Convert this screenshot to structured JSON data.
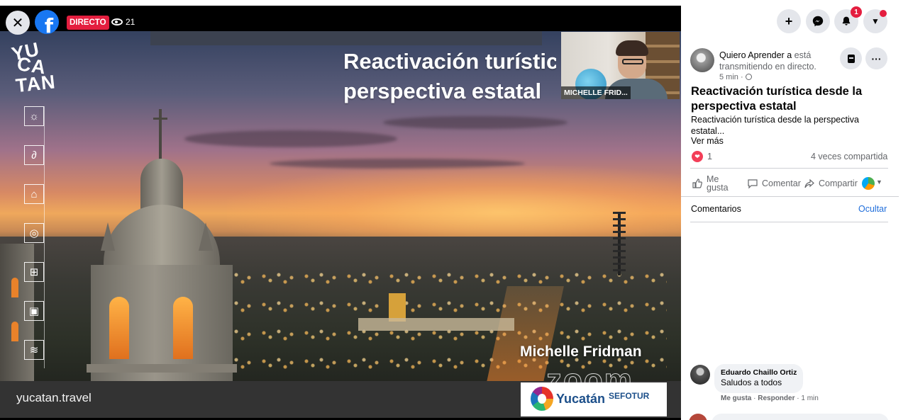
{
  "video": {
    "live_label": "DIRECTO",
    "viewer_count": "21",
    "slide_title": "Reactivación turístic\nperspectiva estatal",
    "brand_lines": [
      "YU",
      "CA",
      "TAN"
    ],
    "footer_site": "yucatan.travel",
    "speaker_name": "Michelle Fridman",
    "zoom_watermark": "zoom",
    "pip_label": "MICHELLE FRID...",
    "logo_word": "Yucatán",
    "logo_org": "SEFOTUR"
  },
  "topbar": {
    "notification_count": "1"
  },
  "post": {
    "page_name": "Quiero Aprender a",
    "status_text": "está transmitiendo en directo.",
    "time": "5 min ·",
    "title": "Reactivación turística desde la perspectiva estatal",
    "description": "Reactivación turística desde la perspectiva estatal...",
    "see_more": "Ver más",
    "reaction_count": "1",
    "shares": "4 veces compartida"
  },
  "actions": {
    "like": "Me gusta",
    "comment": "Comentar",
    "share": "Compartir"
  },
  "comments": {
    "header": "Comentarios",
    "hide": "Ocultar",
    "items": [
      {
        "author": "Eduardo Chaillo Ortiz",
        "text": "Saludos a todos",
        "like": "Me gusta",
        "reply": "Responder",
        "time": "1 min"
      }
    ]
  },
  "icons": {
    "close": "close-icon",
    "facebook": "facebook-logo-icon",
    "eye": "eye-icon",
    "plus": "plus-icon",
    "messenger": "messenger-icon",
    "bell": "bell-icon",
    "caret": "caret-down-icon",
    "bookmark": "bookmark-icon",
    "more": "more-icon",
    "heart": "heart-icon",
    "like": "thumbs-up-icon",
    "comment": "comment-icon",
    "share": "share-icon"
  },
  "colors": {
    "facebook_blue": "#1877f2",
    "live_red": "#e41e3f",
    "link_blue": "#216fdb",
    "heart_red": "#f33e58"
  }
}
